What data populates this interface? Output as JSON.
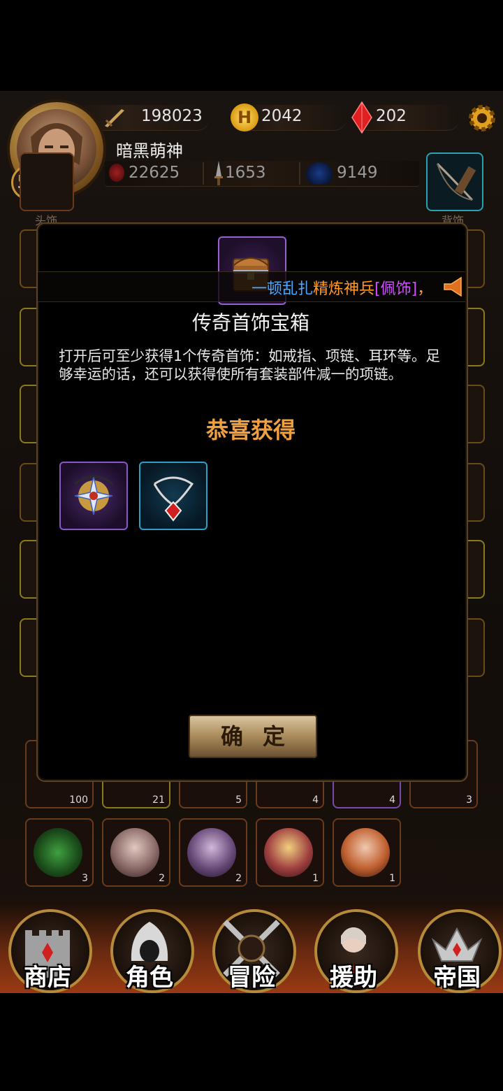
{
  "player": {
    "level": "52",
    "name": "暗黑萌神",
    "combat_power": "198023",
    "gold": "2042",
    "gems": "202",
    "stat_hp": "22625",
    "stat_attack": "1653",
    "stat_mana": "9149"
  },
  "equipment_labels": {
    "head": "头饰",
    "back": "背饰"
  },
  "ticker": {
    "segments": [
      {
        "text": "一顿乱扎",
        "color": "#4aa8ff"
      },
      {
        "text": "精炼神兵",
        "color": "#ff9a2a"
      },
      {
        "text": "[佩饰]",
        "color": "#d050ff"
      },
      {
        "text": "，",
        "color": "#ff9a2a"
      }
    ]
  },
  "dialog": {
    "title": "传奇首饰宝箱",
    "description": "打开后可至少获得1个传奇首饰：如戒指、项链、耳环等。足够幸运的话，还可以获得使所有套装部件减一的项链。",
    "congrats": "恭喜获得",
    "confirm_label": "确定",
    "rewards": [
      {
        "icon": "star-amulet-icon",
        "rarity": "purple"
      },
      {
        "icon": "red-gem-necklace-icon",
        "rarity": "blue"
      }
    ]
  },
  "inventory_row1_counts": [
    "100",
    "21",
    "5",
    "4",
    "4",
    "3"
  ],
  "inventory_row2_counts": [
    "3",
    "2",
    "2",
    "1",
    "1"
  ],
  "nav": [
    {
      "label": "商店",
      "icon": "castle-icon"
    },
    {
      "label": "角色",
      "icon": "hooded-figure-icon"
    },
    {
      "label": "冒险",
      "icon": "crossed-swords-icon"
    },
    {
      "label": "援助",
      "icon": "support-character-icon"
    },
    {
      "label": "帝国",
      "icon": "crown-icon"
    }
  ],
  "colors": {
    "title_gold": "#f0a040",
    "purple_rarity": "#8a55c8",
    "blue_rarity": "#2aa0c8"
  }
}
